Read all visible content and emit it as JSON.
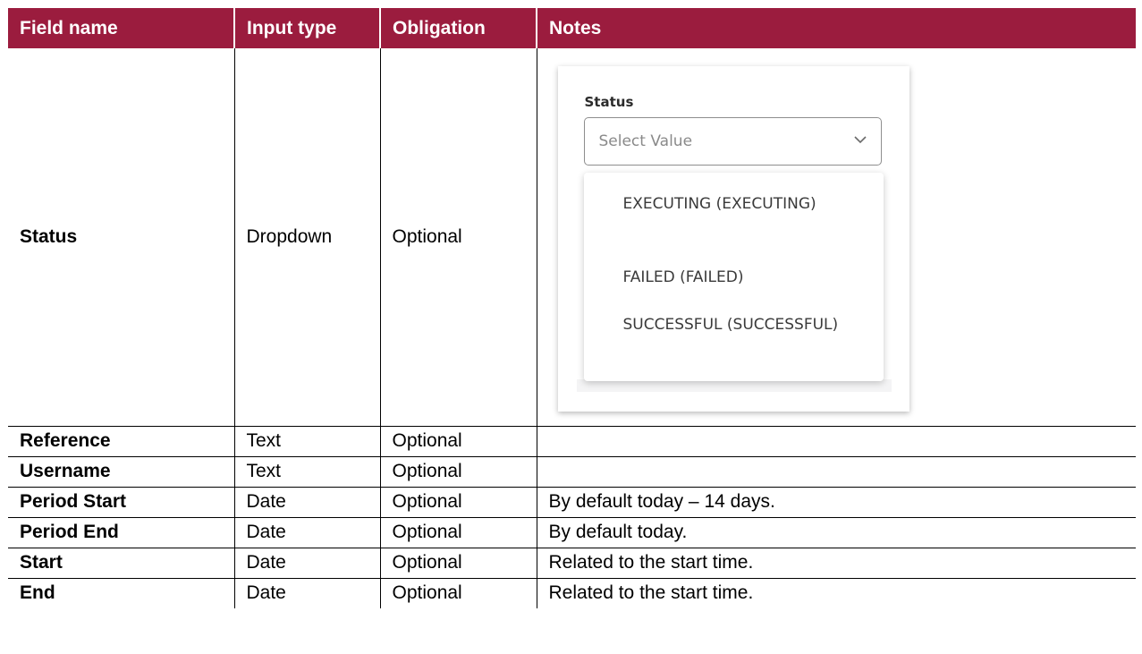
{
  "table": {
    "headers": [
      "Field name",
      "Input type",
      "Obligation",
      "Notes"
    ],
    "rows": [
      {
        "field": "Status",
        "type": "Dropdown",
        "obligation": "Optional",
        "notes": ""
      },
      {
        "field": "Reference",
        "type": "Text",
        "obligation": "Optional",
        "notes": ""
      },
      {
        "field": "Username",
        "type": "Text",
        "obligation": "Optional",
        "notes": ""
      },
      {
        "field": "Period Start",
        "type": "Date",
        "obligation": "Optional",
        "notes": "By default today – 14 days."
      },
      {
        "field": "Period End",
        "type": "Date",
        "obligation": "Optional",
        "notes": "By default today."
      },
      {
        "field": "Start",
        "type": "Date",
        "obligation": "Optional",
        "notes": "Related to the start time."
      },
      {
        "field": "End",
        "type": "Date",
        "obligation": "Optional",
        "notes": "Related to the start time."
      }
    ]
  },
  "status_widget": {
    "label": "Status",
    "placeholder": "Select Value",
    "icon": "chevron-down-icon",
    "options": [
      "EXECUTING (EXECUTING)",
      "FAILED (FAILED)",
      "SUCCESSFUL (SUCCESSFUL)"
    ]
  },
  "colors": {
    "header_bg": "#9b1c3e",
    "header_text": "#ffffff"
  }
}
